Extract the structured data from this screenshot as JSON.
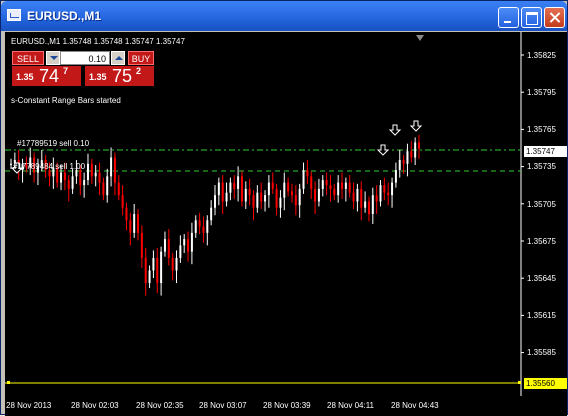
{
  "window": {
    "title": "EURUSD.,M1"
  },
  "chart_header": {
    "symbol_line": "EURUSD.,M1  1.35748  1.35748  1.35747  1.35747"
  },
  "trade_panel": {
    "sell_label": "SELL",
    "buy_label": "BUY",
    "lot_value": "0.10",
    "sell_price": {
      "prefix": "1.35",
      "big": "74",
      "sup": "7"
    },
    "buy_price": {
      "prefix": "1.35",
      "big": "75",
      "sup": "2"
    }
  },
  "ea_status": "s-Constant Range Bars started",
  "orders": [
    {
      "label": "#17789519 sell 0.10"
    },
    {
      "label": "#17789484 sell 1.00"
    }
  ],
  "price_axis": {
    "ticks": [
      "1.35825",
      "1.35795",
      "1.35765",
      "1.35735",
      "1.35705",
      "1.35675",
      "1.35645",
      "1.35615",
      "1.35585"
    ],
    "current_price": "1.35747",
    "low_marker": "1.35560"
  },
  "time_axis": {
    "ticks": [
      "28 Nov 2013",
      "28 Nov 02:03",
      "28 Nov 02:35",
      "28 Nov 03:07",
      "28 Nov 03:39",
      "28 Nov 04:11",
      "28 Nov 04:43"
    ]
  },
  "colors": {
    "background": "#000000",
    "candle_up": "#ffffff",
    "candle_down": "#ff0000",
    "order_line": "#32cd32",
    "bid_box": "#ffffff",
    "low_box": "#ffff00",
    "panel_red": "#c21818"
  },
  "chart_data": {
    "type": "candlestick",
    "symbol": "EURUSD.",
    "timeframe": "M1",
    "ylim": [
      1.3555,
      1.3584
    ],
    "close_series": [
      1.35735,
      1.35738,
      1.3573,
      1.35735,
      1.35732,
      1.3574,
      1.35728,
      1.35733,
      1.35738,
      1.3573,
      1.35725,
      1.35732,
      1.3572,
      1.35728,
      1.35722,
      1.35715,
      1.35725,
      1.3573,
      1.35718,
      1.35722,
      1.35735,
      1.35725,
      1.35728,
      1.3572,
      1.3571,
      1.35725,
      1.3574,
      1.3572,
      1.3571,
      1.357,
      1.3569,
      1.3568,
      1.35695,
      1.3568,
      1.3566,
      1.3564,
      1.3565,
      1.3566,
      1.3564,
      1.35665,
      1.35675,
      1.3566,
      1.3565,
      1.3566,
      1.3567,
      1.35675,
      1.35665,
      1.3568,
      1.3569,
      1.35685,
      1.3568,
      1.3569,
      1.357,
      1.3571,
      1.3572,
      1.35705,
      1.35712,
      1.3572,
      1.35715,
      1.35725,
      1.35705,
      1.35715,
      1.3571,
      1.357,
      1.35712,
      1.35705,
      1.3571,
      1.3572,
      1.35715,
      1.357,
      1.35708,
      1.3572,
      1.35713,
      1.3571,
      1.35702,
      1.35715,
      1.3573,
      1.35725,
      1.35715,
      1.35705,
      1.35715,
      1.35722,
      1.35718,
      1.35715,
      1.3571,
      1.3572,
      1.35715,
      1.3572,
      1.35712,
      1.35705,
      1.35715,
      1.357,
      1.35705,
      1.35695,
      1.3571,
      1.35705,
      1.35718,
      1.35712,
      1.3571,
      1.3572,
      1.3573,
      1.35738,
      1.35735,
      1.35745,
      1.3574,
      1.35752,
      1.35747
    ]
  }
}
